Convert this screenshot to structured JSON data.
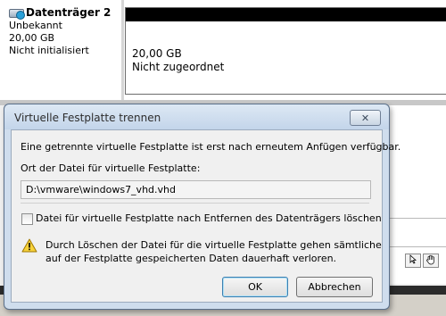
{
  "disk": {
    "name": "Datenträger 2",
    "type": "Unbekannt",
    "size": "20,00 GB",
    "status": "Nicht initialisiert"
  },
  "partition": {
    "size": "20,00 GB",
    "status": "Nicht zugeordnet"
  },
  "dialog": {
    "title": "Virtuelle Festplatte trennen",
    "close_label": "✕",
    "info_text": "Eine getrennte virtuelle Festplatte ist erst nach erneutem Anfügen verfügbar.",
    "path_label": "Ort der Datei für virtuelle Festplatte:",
    "path_value": "D:\\vmware\\windows7_vhd.vhd",
    "checkbox_label": "Datei für virtuelle Festplatte nach Entfernen des Datenträgers löschen",
    "checkbox_checked": false,
    "warning_line1": "Durch Löschen der Datei für die virtuelle Festplatte gehen sämtliche",
    "warning_line2": "auf der Festplatte gespeicherten Daten dauerhaft verloren.",
    "ok_label": "OK",
    "cancel_label": "Abbrechen"
  },
  "icons": {
    "disk": "virtual-disk-icon",
    "warning": "warning-icon",
    "close": "close-icon",
    "select_tool": "pointer-tool-icon",
    "hand_tool": "hand-tool-icon"
  },
  "colors": {
    "titlebar": "#c3d5ea",
    "dialog_frame": "#cfdded",
    "ok_focus": "#3c7fb1",
    "partition_bar": "#000000"
  }
}
